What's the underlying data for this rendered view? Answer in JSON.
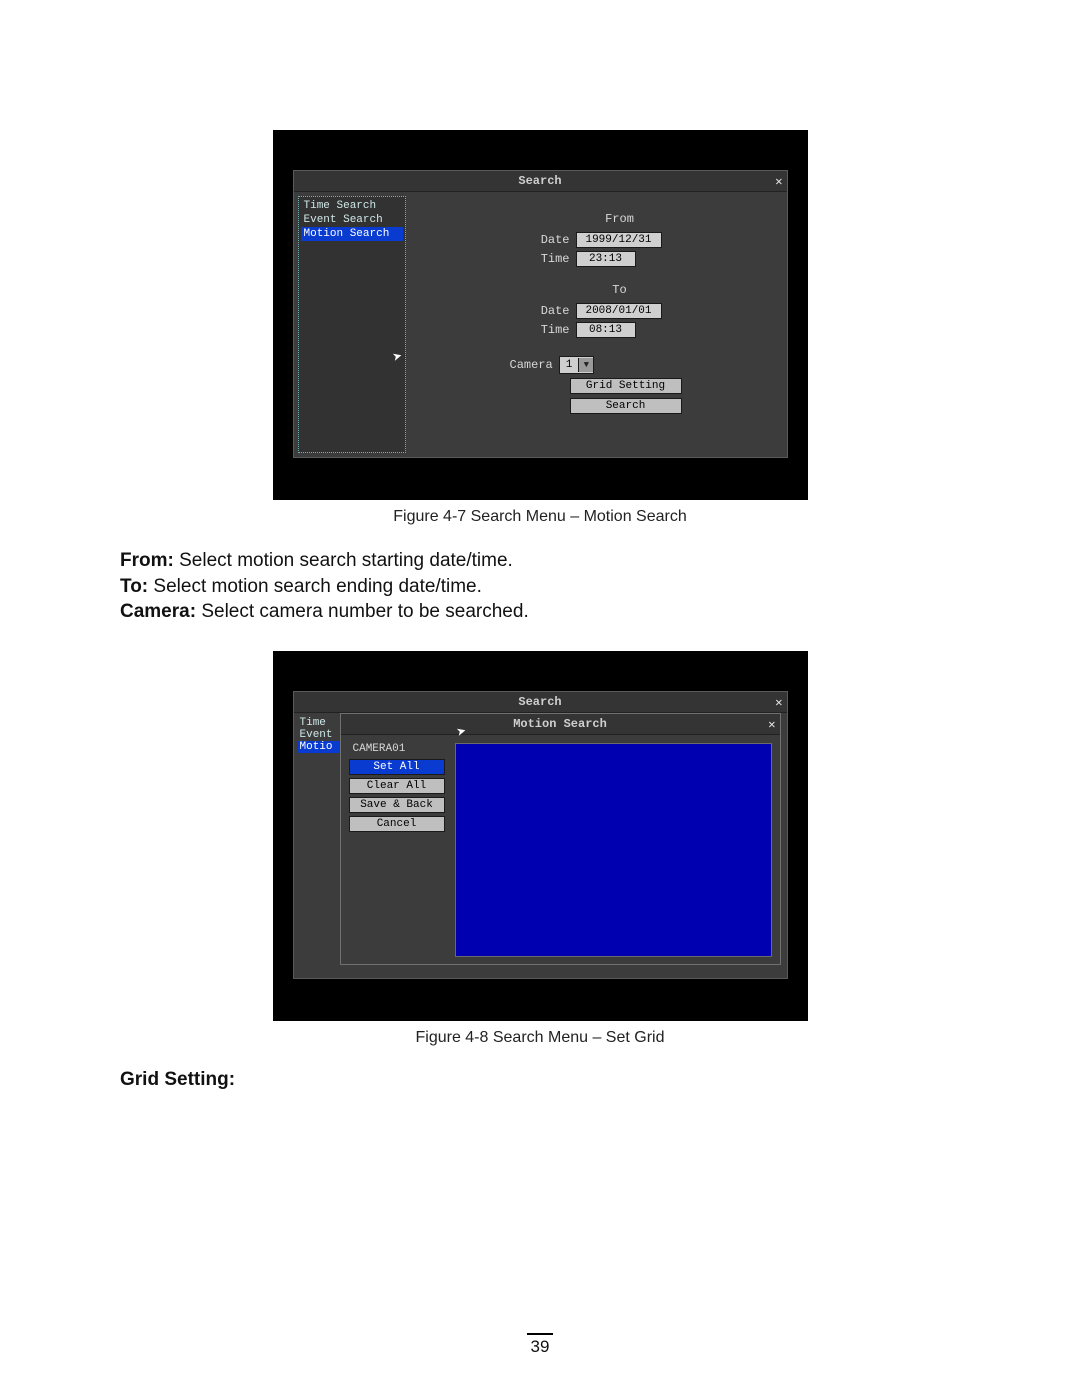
{
  "fig1": {
    "window_title": "Search",
    "sidemenu": [
      {
        "label": "Time Search",
        "selected": false
      },
      {
        "label": "Event Search",
        "selected": false
      },
      {
        "label": "Motion Search",
        "selected": true
      }
    ],
    "from_label": "From",
    "to_label": "To",
    "date_label": "Date",
    "time_label": "Time",
    "from_date": "1999/12/31",
    "from_time": "23:13",
    "to_date": "2008/01/01",
    "to_time": "08:13",
    "camera_label": "Camera",
    "camera_value": "1",
    "grid_setting_btn": "Grid Setting",
    "search_btn": "Search"
  },
  "fig1_caption": "Figure 4-7  Search Menu – Motion Search",
  "explain": {
    "from_b": "From:",
    "from_t": " Select motion search starting date/time.",
    "to_b": "To:",
    "to_t": " Select motion search ending date/time.",
    "cam_b": "Camera:",
    "cam_t": " Select camera number to be searched."
  },
  "fig2": {
    "window_title": "Search",
    "modal_title": "Motion Search",
    "sidemenu": [
      {
        "label": "Time",
        "selected": false
      },
      {
        "label": "Event",
        "selected": false
      },
      {
        "label": "Motio",
        "selected": true
      }
    ],
    "camera_name": "CAMERA01",
    "buttons": [
      {
        "label": "Set All",
        "selected": true
      },
      {
        "label": "Clear All",
        "selected": false
      },
      {
        "label": "Save & Back",
        "selected": false
      },
      {
        "label": "Cancel",
        "selected": false
      }
    ]
  },
  "fig2_caption": "Figure 4-8  Search Menu – Set Grid",
  "section_heading": "Grid Setting:",
  "page_number": "39"
}
